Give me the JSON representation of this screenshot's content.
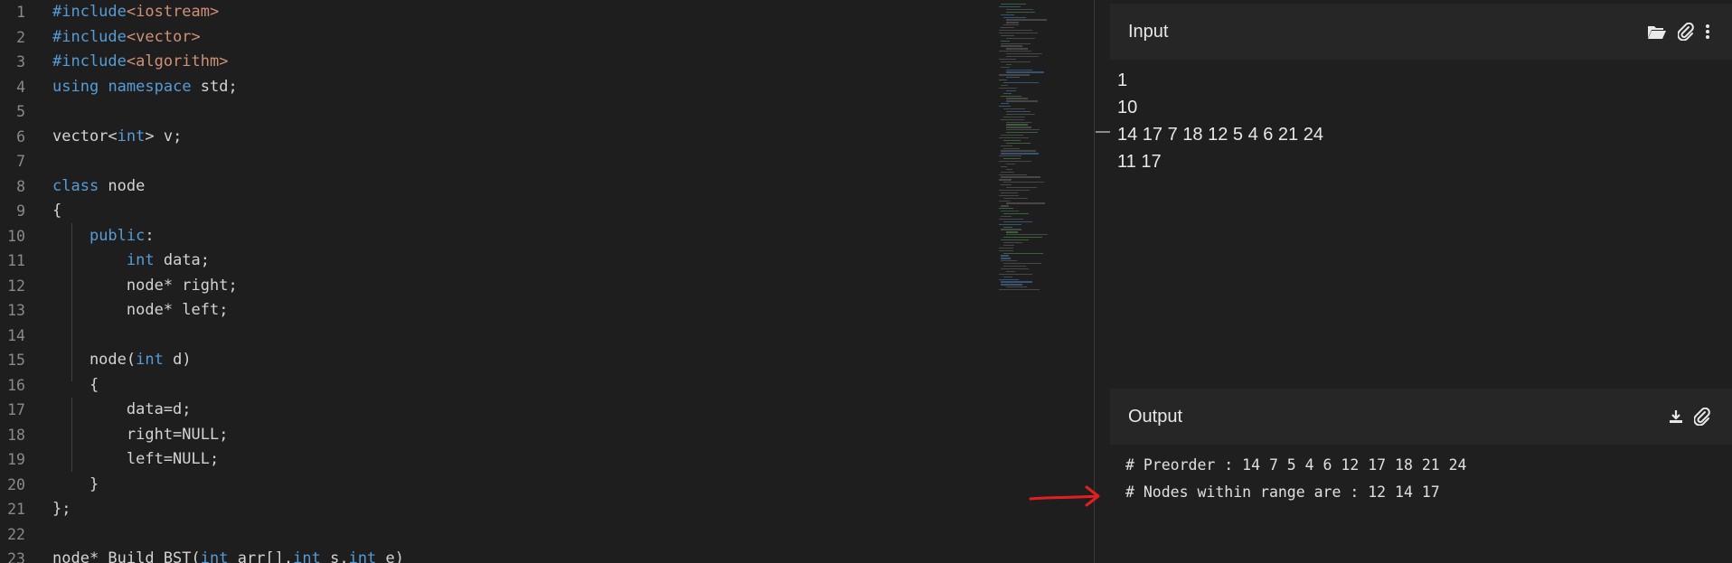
{
  "editor": {
    "lines": [
      {
        "n": "1",
        "tokens": [
          {
            "t": "#include",
            "c": "pp"
          },
          {
            "t": "<iostream>",
            "c": "str"
          }
        ]
      },
      {
        "n": "2",
        "tokens": [
          {
            "t": "#include",
            "c": "pp"
          },
          {
            "t": "<vector>",
            "c": "str"
          }
        ]
      },
      {
        "n": "3",
        "tokens": [
          {
            "t": "#include",
            "c": "pp"
          },
          {
            "t": "<algorithm>",
            "c": "str"
          }
        ]
      },
      {
        "n": "4",
        "tokens": [
          {
            "t": "using",
            "c": "kw"
          },
          {
            "t": " ",
            "c": "tx"
          },
          {
            "t": "namespace",
            "c": "kw"
          },
          {
            "t": " std;",
            "c": "tx"
          }
        ]
      },
      {
        "n": "5",
        "tokens": []
      },
      {
        "n": "6",
        "tokens": [
          {
            "t": "vector<",
            "c": "tx"
          },
          {
            "t": "int",
            "c": "kw"
          },
          {
            "t": "> v;",
            "c": "tx"
          }
        ]
      },
      {
        "n": "7",
        "tokens": []
      },
      {
        "n": "8",
        "tokens": [
          {
            "t": "class",
            "c": "kw"
          },
          {
            "t": " node",
            "c": "tx"
          }
        ]
      },
      {
        "n": "9",
        "tokens": [
          {
            "t": "{",
            "c": "tx"
          }
        ]
      },
      {
        "n": "10",
        "tokens": [
          {
            "t": "    ",
            "c": "tx"
          },
          {
            "t": "public",
            "c": "kw"
          },
          {
            "t": ":",
            "c": "tx"
          }
        ]
      },
      {
        "n": "11",
        "tokens": [
          {
            "t": "        ",
            "c": "tx"
          },
          {
            "t": "int",
            "c": "kw"
          },
          {
            "t": " data;",
            "c": "tx"
          }
        ]
      },
      {
        "n": "12",
        "tokens": [
          {
            "t": "        node* right;",
            "c": "tx"
          }
        ]
      },
      {
        "n": "13",
        "tokens": [
          {
            "t": "        node* left;",
            "c": "tx"
          }
        ]
      },
      {
        "n": "14",
        "tokens": []
      },
      {
        "n": "15",
        "tokens": [
          {
            "t": "    node(",
            "c": "tx"
          },
          {
            "t": "int",
            "c": "kw"
          },
          {
            "t": " d)",
            "c": "tx"
          }
        ]
      },
      {
        "n": "16",
        "tokens": [
          {
            "t": "    {",
            "c": "tx"
          }
        ]
      },
      {
        "n": "17",
        "tokens": [
          {
            "t": "        data=d;",
            "c": "tx"
          }
        ]
      },
      {
        "n": "18",
        "tokens": [
          {
            "t": "        right=NULL;",
            "c": "tx"
          }
        ]
      },
      {
        "n": "19",
        "tokens": [
          {
            "t": "        left=NULL;",
            "c": "tx"
          }
        ]
      },
      {
        "n": "20",
        "tokens": [
          {
            "t": "    }",
            "c": "tx"
          }
        ]
      },
      {
        "n": "21",
        "tokens": [
          {
            "t": "};",
            "c": "tx"
          }
        ]
      },
      {
        "n": "22",
        "tokens": []
      },
      {
        "n": "23",
        "tokens": [
          {
            "t": "node* Build_BST(",
            "c": "tx"
          },
          {
            "t": "int",
            "c": "kw"
          },
          {
            "t": " arr[],",
            "c": "tx"
          },
          {
            "t": "int",
            "c": "kw"
          },
          {
            "t": " s,",
            "c": "tx"
          },
          {
            "t": "int",
            "c": "kw"
          },
          {
            "t": " e)",
            "c": "tx"
          }
        ]
      }
    ]
  },
  "input_panel": {
    "title": "Input",
    "lines": [
      "1",
      "10",
      "14 17 7 18 12 5 4 6 21 24",
      "11 17"
    ],
    "icons": [
      "folder-open-icon",
      "paperclip-icon",
      "more-vertical-icon"
    ]
  },
  "output_panel": {
    "title": "Output",
    "lines": [
      "# Preorder : 14 7 5 4 6 12 17 18 21 24",
      "# Nodes within range are : 12 14 17"
    ],
    "icons": [
      "download-icon",
      "paperclip-icon"
    ]
  },
  "colors": {
    "keyword": "#569cd6",
    "string": "#ce9178",
    "text": "#d4d4d4",
    "panel_header": "#262626",
    "annotation_arrow": "#e02020"
  }
}
